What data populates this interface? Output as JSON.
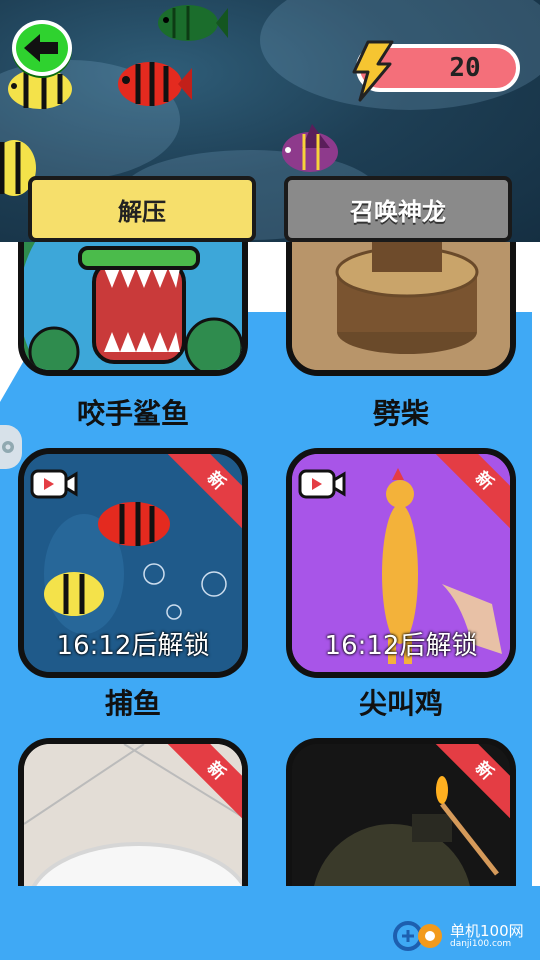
{
  "header": {
    "energy_value": "20",
    "tabs": [
      {
        "label": "解压",
        "active": true
      },
      {
        "label": "召唤神龙",
        "active": false
      }
    ]
  },
  "games": [
    {
      "title": "咬手鲨鱼",
      "is_new": false,
      "locked": false
    },
    {
      "title": "劈柴",
      "is_new": false,
      "locked": false
    },
    {
      "title": "捕鱼",
      "is_new": true,
      "new_badge": "新",
      "locked": true,
      "unlock_text": "16:12后解锁"
    },
    {
      "title": "尖叫鸡",
      "is_new": true,
      "new_badge": "新",
      "locked": true,
      "unlock_text": "16:12后解锁"
    },
    {
      "title": "",
      "is_new": true,
      "new_badge": "新",
      "locked": false
    },
    {
      "title": "",
      "is_new": true,
      "new_badge": "新",
      "locked": false
    }
  ],
  "watermark": {
    "main": "单机100网",
    "sub": "danji100.com"
  },
  "colors": {
    "page_bg": "#3FA9F5",
    "active_tab": "#f6df6b",
    "inactive_tab": "#8a8a8a",
    "energy_pill": "#f46f7a",
    "back_button": "#2fd22f",
    "new_ribbon": "#e43d44"
  },
  "icons": [
    "back-arrow-icon",
    "lightning-bolt-icon",
    "video-ad-icon",
    "settings-gear-icon"
  ]
}
